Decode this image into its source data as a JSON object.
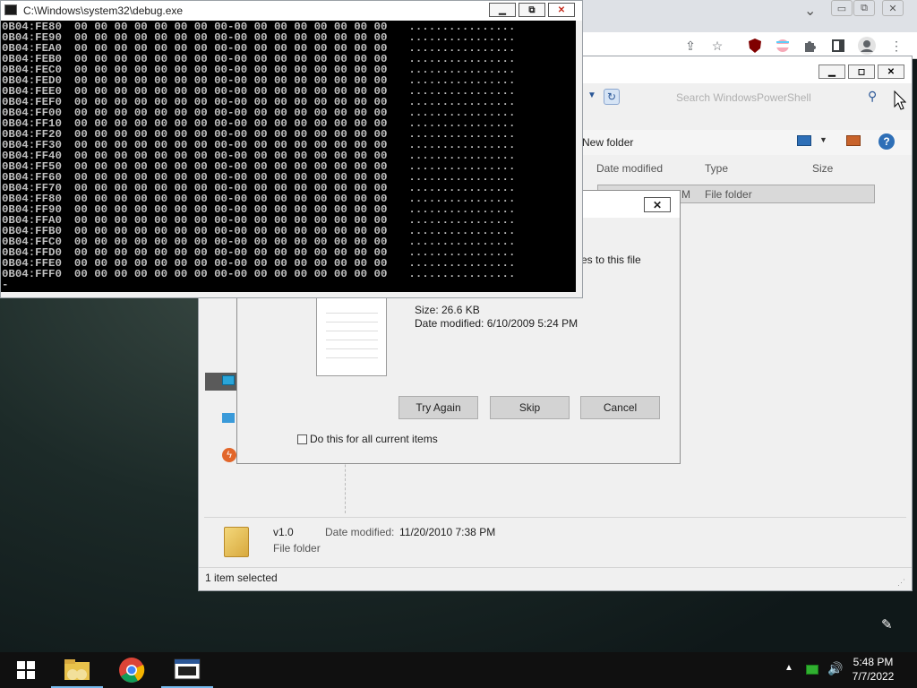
{
  "chrome": {
    "controls": [
      "▭",
      "⧉",
      "✕"
    ],
    "tab_chevron": "⌄"
  },
  "explorer": {
    "search_placeholder": "Search WindowsPowerShell",
    "new_folder": "New folder",
    "columns": {
      "date_modified": "Date modified",
      "type": "Type",
      "size": "Size"
    },
    "row": {
      "date_fragment": "M",
      "type": "File folder"
    },
    "details": {
      "name": "v1.0",
      "date_label": "Date modified:",
      "date_value": "11/20/2010 7:38 PM",
      "type": "File folder"
    },
    "status": "1 item selected"
  },
  "dialog": {
    "message_fragment": "es to this file",
    "size": "Size: 26.6 KB",
    "date_modified": "Date modified: 6/10/2009 5:24 PM",
    "buttons": {
      "try_again": "Try Again",
      "skip": "Skip",
      "cancel": "Cancel"
    },
    "checkbox_label": "Do this for all current items",
    "checkbox_checked": false
  },
  "console": {
    "title": "C:\\Windows\\system32\\debug.exe",
    "rows": [
      {
        "address": "0B04:FE80",
        "bytes": "00 00 00 00 00 00 00 00-00 00 00 00 00 00 00 00",
        "ascii": "................"
      },
      {
        "address": "0B04:FE90",
        "bytes": "00 00 00 00 00 00 00 00-00 00 00 00 00 00 00 00",
        "ascii": "................"
      },
      {
        "address": "0B04:FEA0",
        "bytes": "00 00 00 00 00 00 00 00-00 00 00 00 00 00 00 00",
        "ascii": "................"
      },
      {
        "address": "0B04:FEB0",
        "bytes": "00 00 00 00 00 00 00 00-00 00 00 00 00 00 00 00",
        "ascii": "................"
      },
      {
        "address": "0B04:FEC0",
        "bytes": "00 00 00 00 00 00 00 00-00 00 00 00 00 00 00 00",
        "ascii": "................"
      },
      {
        "address": "0B04:FED0",
        "bytes": "00 00 00 00 00 00 00 00-00 00 00 00 00 00 00 00",
        "ascii": "................"
      },
      {
        "address": "0B04:FEE0",
        "bytes": "00 00 00 00 00 00 00 00-00 00 00 00 00 00 00 00",
        "ascii": "................"
      },
      {
        "address": "0B04:FEF0",
        "bytes": "00 00 00 00 00 00 00 00-00 00 00 00 00 00 00 00",
        "ascii": "................"
      },
      {
        "address": "0B04:FF00",
        "bytes": "00 00 00 00 00 00 00 00-00 00 00 00 00 00 00 00",
        "ascii": "................"
      },
      {
        "address": "0B04:FF10",
        "bytes": "00 00 00 00 00 00 00 00-00 00 00 00 00 00 00 00",
        "ascii": "................"
      },
      {
        "address": "0B04:FF20",
        "bytes": "00 00 00 00 00 00 00 00-00 00 00 00 00 00 00 00",
        "ascii": "................"
      },
      {
        "address": "0B04:FF30",
        "bytes": "00 00 00 00 00 00 00 00-00 00 00 00 00 00 00 00",
        "ascii": "................"
      },
      {
        "address": "0B04:FF40",
        "bytes": "00 00 00 00 00 00 00 00-00 00 00 00 00 00 00 00",
        "ascii": "................"
      },
      {
        "address": "0B04:FF50",
        "bytes": "00 00 00 00 00 00 00 00-00 00 00 00 00 00 00 00",
        "ascii": "................"
      },
      {
        "address": "0B04:FF60",
        "bytes": "00 00 00 00 00 00 00 00-00 00 00 00 00 00 00 00",
        "ascii": "................"
      },
      {
        "address": "0B04:FF70",
        "bytes": "00 00 00 00 00 00 00 00-00 00 00 00 00 00 00 00",
        "ascii": "................"
      },
      {
        "address": "0B04:FF80",
        "bytes": "00 00 00 00 00 00 00 00-00 00 00 00 00 00 00 00",
        "ascii": "................"
      },
      {
        "address": "0B04:FF90",
        "bytes": "00 00 00 00 00 00 00 00-00 00 00 00 00 00 00 00",
        "ascii": "................"
      },
      {
        "address": "0B04:FFA0",
        "bytes": "00 00 00 00 00 00 00 00-00 00 00 00 00 00 00 00",
        "ascii": "................"
      },
      {
        "address": "0B04:FFB0",
        "bytes": "00 00 00 00 00 00 00 00-00 00 00 00 00 00 00 00",
        "ascii": "................"
      },
      {
        "address": "0B04:FFC0",
        "bytes": "00 00 00 00 00 00 00 00-00 00 00 00 00 00 00 00",
        "ascii": "................"
      },
      {
        "address": "0B04:FFD0",
        "bytes": "00 00 00 00 00 00 00 00-00 00 00 00 00 00 00 00",
        "ascii": "................"
      },
      {
        "address": "0B04:FFE0",
        "bytes": "00 00 00 00 00 00 00 00-00 00 00 00 00 00 00 00",
        "ascii": "................"
      },
      {
        "address": "0B04:FFF0",
        "bytes": "00 00 00 00 00 00 00 00-00 00 00 00 00 00 00 00",
        "ascii": "................"
      }
    ],
    "prompt": "-"
  },
  "taskbar": {
    "time": "5:48 PM",
    "date": "7/7/2022",
    "apps": [
      "file-explorer-icon",
      "chrome-icon",
      "debug-console-icon"
    ]
  },
  "colors": {
    "console_bg": "#000000",
    "console_text": "#c0c0c0",
    "taskbar_bg": "#101010",
    "active_indicator": "#76b9ed",
    "close_red": "#c42b1c"
  }
}
